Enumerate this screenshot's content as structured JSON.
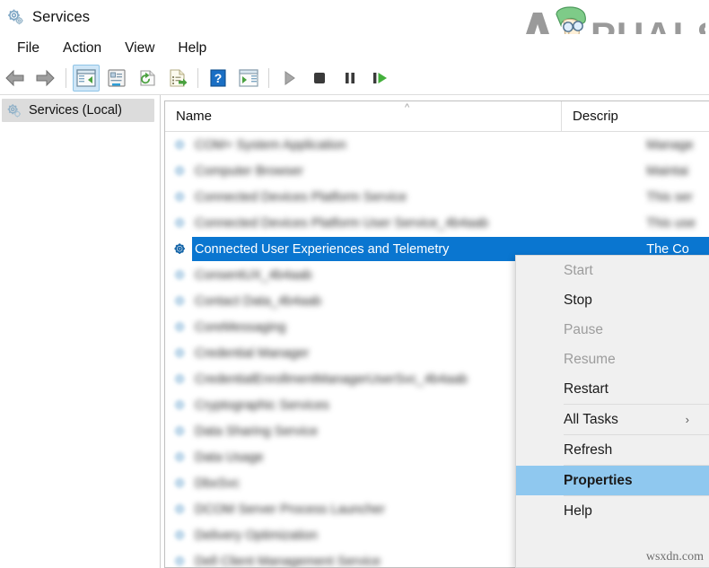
{
  "window": {
    "title": "Services",
    "icon": "services-gear-icon"
  },
  "branding": {
    "logo_text": "APPUALS",
    "watermark": "wsxdn.com"
  },
  "menubar": {
    "items": [
      {
        "label": "File"
      },
      {
        "label": "Action"
      },
      {
        "label": "View"
      },
      {
        "label": "Help"
      }
    ]
  },
  "toolbar": {
    "buttons": [
      {
        "name": "back-icon",
        "title": "Back"
      },
      {
        "name": "forward-icon",
        "title": "Forward"
      },
      {
        "name": "show-hide-console-tree-icon",
        "title": "Show/Hide Console Tree",
        "active": true
      },
      {
        "name": "properties-icon",
        "title": "Properties"
      },
      {
        "name": "refresh-icon",
        "title": "Refresh"
      },
      {
        "name": "export-list-icon",
        "title": "Export List"
      },
      {
        "name": "help-icon",
        "title": "Help"
      },
      {
        "name": "show-action-pane-icon",
        "title": "Show/Hide Action Pane"
      },
      {
        "name": "start-service-icon",
        "title": "Start Service"
      },
      {
        "name": "stop-service-icon",
        "title": "Stop Service"
      },
      {
        "name": "pause-service-icon",
        "title": "Pause Service"
      },
      {
        "name": "restart-service-icon",
        "title": "Restart Service"
      }
    ]
  },
  "tree": {
    "items": [
      {
        "label": "Services (Local)",
        "icon": "services-gear-icon",
        "selected": true
      }
    ]
  },
  "list": {
    "columns": [
      {
        "label": "Name",
        "sorted": "ascending"
      },
      {
        "label": "Descrip"
      }
    ],
    "sort_indicator": "^",
    "rows": [
      {
        "name": "COM+ System Application",
        "description": "Manage",
        "blurred": true,
        "selected": false
      },
      {
        "name": "Computer Browser",
        "description": "Maintai",
        "blurred": true,
        "selected": false
      },
      {
        "name": "Connected Devices Platform Service",
        "description": "This ser",
        "blurred": true,
        "selected": false
      },
      {
        "name": "Connected Devices Platform User Service_4b4aab",
        "description": "This use",
        "blurred": true,
        "selected": false
      },
      {
        "name": "Connected User Experiences and Telemetry",
        "description": "The Co",
        "blurred": false,
        "selected": true
      },
      {
        "name": "ConsentUX_4b4aab",
        "description": "",
        "blurred": true,
        "selected": false
      },
      {
        "name": "Contact Data_4b4aab",
        "description": "",
        "blurred": true,
        "selected": false
      },
      {
        "name": "CoreMessaging",
        "description": "",
        "blurred": true,
        "selected": false
      },
      {
        "name": "Credential Manager",
        "description": "",
        "blurred": true,
        "selected": false
      },
      {
        "name": "CredentialEnrollmentManagerUserSvc_4b4aab",
        "description": "",
        "blurred": true,
        "selected": false
      },
      {
        "name": "Cryptographic Services",
        "description": "",
        "blurred": true,
        "selected": false
      },
      {
        "name": "Data Sharing Service",
        "description": "",
        "blurred": true,
        "selected": false
      },
      {
        "name": "Data Usage",
        "description": "",
        "blurred": true,
        "selected": false
      },
      {
        "name": "DbxSvc",
        "description": "",
        "blurred": true,
        "selected": false
      },
      {
        "name": "DCOM Server Process Launcher",
        "description": "",
        "blurred": true,
        "selected": false
      },
      {
        "name": "Delivery Optimization",
        "description": "",
        "blurred": true,
        "selected": false
      },
      {
        "name": "Dell Client Management Service",
        "description": "",
        "blurred": true,
        "selected": false
      }
    ]
  },
  "context_menu": {
    "items": [
      {
        "label": "Start",
        "state": "disabled",
        "type": "item"
      },
      {
        "label": "Stop",
        "state": "enabled",
        "type": "item"
      },
      {
        "label": "Pause",
        "state": "disabled",
        "type": "item"
      },
      {
        "label": "Resume",
        "state": "disabled",
        "type": "item"
      },
      {
        "label": "Restart",
        "state": "enabled",
        "type": "item"
      },
      {
        "label": "",
        "type": "separator"
      },
      {
        "label": "All Tasks",
        "state": "enabled",
        "type": "submenu",
        "arrow": "›"
      },
      {
        "label": "",
        "type": "separator"
      },
      {
        "label": "Refresh",
        "state": "enabled",
        "type": "item"
      },
      {
        "label": "",
        "type": "separator"
      },
      {
        "label": "Properties",
        "state": "highlight",
        "type": "item"
      },
      {
        "label": "",
        "type": "separator"
      },
      {
        "label": "Help",
        "state": "enabled",
        "type": "item"
      }
    ]
  },
  "colors": {
    "selection_blue": "#0a76d0",
    "menu_highlight": "#8fc8ef",
    "menu_bg": "#f0f0f0",
    "toolbar_active": "#cfe6f7",
    "tree_selected": "#dcdcdc"
  }
}
